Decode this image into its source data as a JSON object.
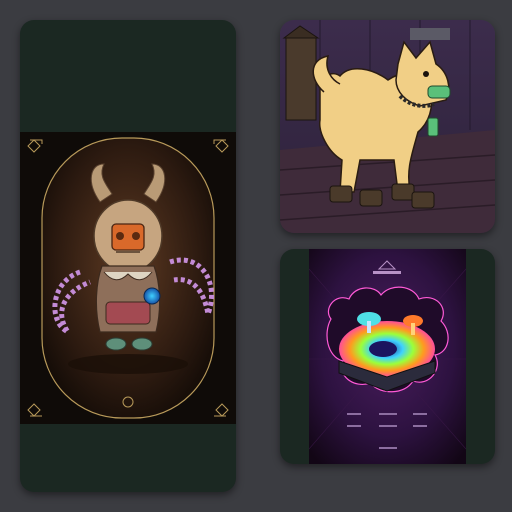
{
  "gallery": {
    "items": [
      {
        "label": "owl-masked-creature-card",
        "icon": "owl-creature-art"
      },
      {
        "label": "shiba-dog-card",
        "icon": "shiba-dog-art"
      },
      {
        "label": "psychedelic-landscape-card",
        "icon": "psychedelic-art"
      }
    ]
  },
  "colors": {
    "background": "#3b3c41",
    "card_frame": "#1b2822",
    "owl_gold": "#c9b37c",
    "dog_fur": "#f1cf86",
    "poster_purple": "#2d1240"
  }
}
